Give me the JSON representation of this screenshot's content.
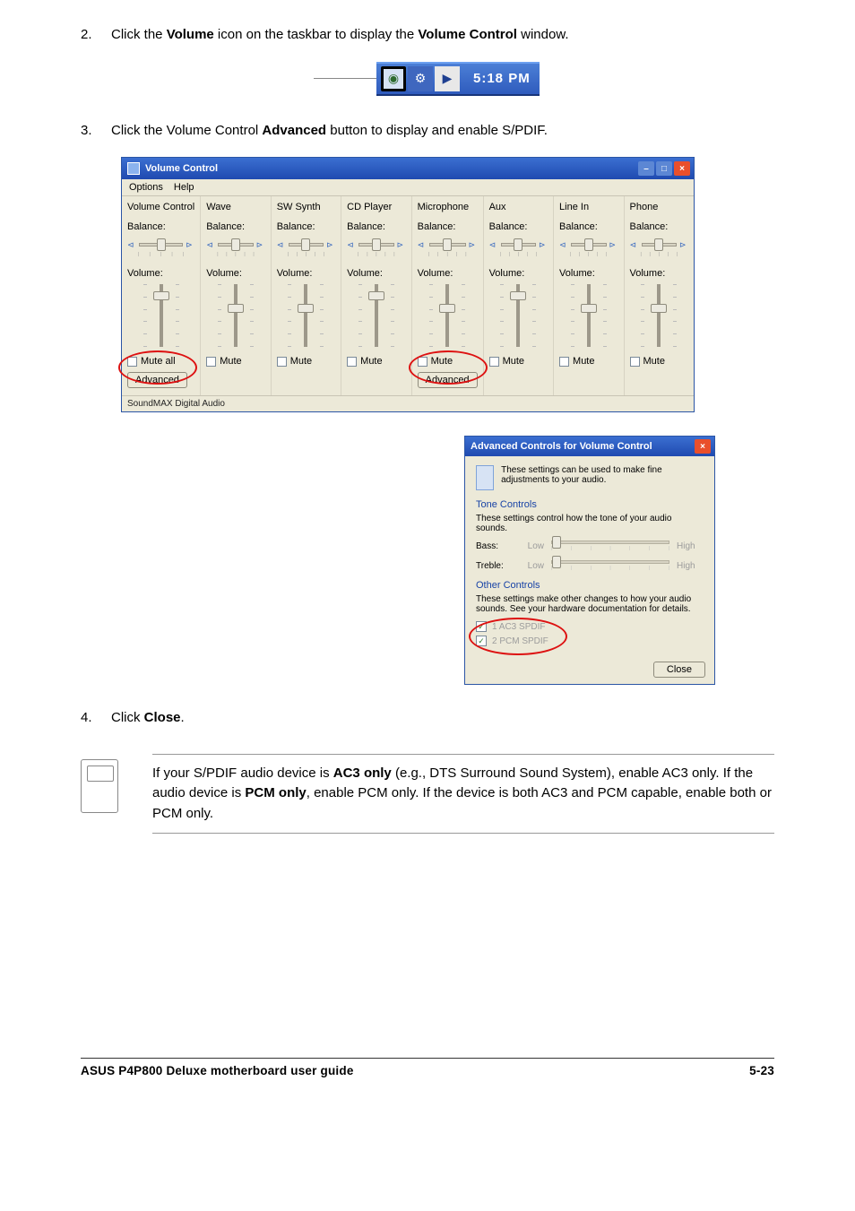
{
  "step2": {
    "num": "2.",
    "text_before": "Click the ",
    "bold1": "Volume",
    "text_mid": " icon on the taskbar to display the ",
    "bold2": "Volume Control",
    "text_after": " window."
  },
  "step3": {
    "num": "3.",
    "text_before": "Click the Volume Control ",
    "bold": "Advanced",
    "text_after": " button to display and enable S/PDIF."
  },
  "taskbar": {
    "clock": "5:18 PM"
  },
  "vc": {
    "title": "Volume Control",
    "menu": {
      "options": "Options",
      "help": "Help"
    },
    "balance_label": "Balance:",
    "volume_label": "Volume:",
    "mute_all": "Mute all",
    "mute": "Mute",
    "advanced": "Advanced",
    "status": "SoundMAX Digital Audio",
    "cols": [
      {
        "title": "Volume Control",
        "thumb": 8,
        "mute_all": true,
        "advanced": true
      },
      {
        "title": "Wave",
        "thumb": 22
      },
      {
        "title": "SW Synth",
        "thumb": 22
      },
      {
        "title": "CD Player",
        "thumb": 8
      },
      {
        "title": "Microphone",
        "thumb": 22,
        "advanced": true
      },
      {
        "title": "Aux",
        "thumb": 8
      },
      {
        "title": "Line In",
        "thumb": 22
      },
      {
        "title": "Phone",
        "thumb": 22
      }
    ]
  },
  "advdlg": {
    "title": "Advanced Controls for Volume Control",
    "desc": "These settings can be used to make fine adjustments to your audio.",
    "tone_head": "Tone Controls",
    "tone_desc": "These settings control how the tone of your audio sounds.",
    "bass_label": "Bass:",
    "treble_label": "Treble:",
    "low": "Low",
    "high": "High",
    "other_head": "Other Controls",
    "other_desc": "These settings make other changes to how your audio sounds. See your hardware documentation for details.",
    "chk1": "1  AC3 SPDIF",
    "chk2": "2  PCM SPDIF",
    "close": "Close"
  },
  "step4": {
    "num": "4.",
    "text_before": "Click ",
    "bold": "Close",
    "text_after": "."
  },
  "note": {
    "text1": "If your S/PDIF audio device is ",
    "b1": "AC3 only",
    "text2": " (e.g., DTS Surround Sound System), enable AC3 only. If the audio device is ",
    "b2": "PCM only",
    "text3": ", enable PCM only. If the device is both AC3 and PCM capable, enable both or PCM only."
  },
  "footer": {
    "left": "ASUS P4P800 Deluxe motherboard user guide",
    "right_page": "5-23"
  }
}
